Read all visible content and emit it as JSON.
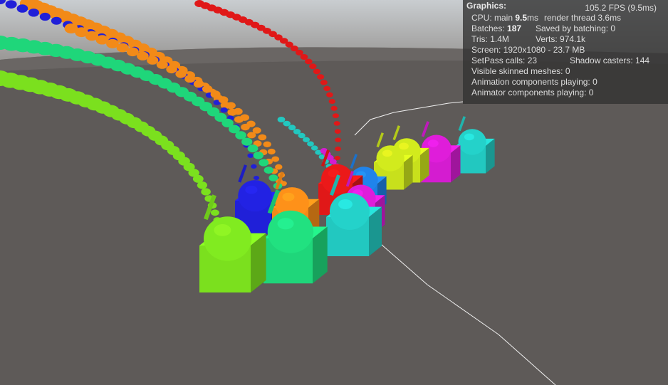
{
  "stats": {
    "title": "Graphics:",
    "fps": "105.2 FPS (9.5ms)",
    "cpu_prefix": "CPU: main ",
    "cpu_main": "9.5",
    "cpu_ms": "ms",
    "render_thread": "render thread 3.6ms",
    "batches_prefix": "Batches: ",
    "batches": "187",
    "saved_by_batching": "Saved by batching: 0",
    "tris": "Tris: 1.4M",
    "verts": "Verts: 974.1k",
    "screen": "Screen: 1920x1080 - 23.7 MB",
    "setpass": "SetPass calls: 23",
    "shadow_casters": "Shadow casters: 144",
    "skinned_meshes": "Visible skinned meshes: 0",
    "animation_components": "Animation components playing: 0",
    "animator_components": "Animator components playing: 0"
  },
  "colors": {
    "ground": "#5e5a58",
    "sky": "#b8bcc0",
    "lime": "#7be01e",
    "green": "#1fd67a",
    "blue": "#2020d8",
    "orange": "#f28a18",
    "red": "#e01818",
    "cyan": "#22c8c0",
    "magenta": "#d41cd0",
    "yellow": "#c8e01c",
    "sky_blue": "#1e7ee0"
  }
}
